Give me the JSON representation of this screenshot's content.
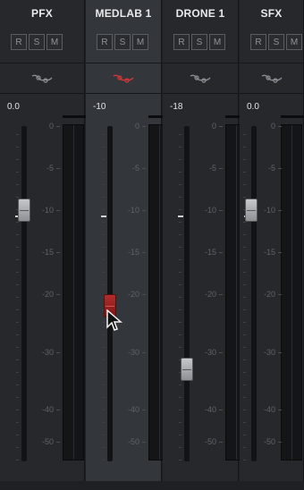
{
  "channels": [
    {
      "name": "PFX",
      "volume": "0.0",
      "selected": false,
      "eq_active": false,
      "fader_db": -10,
      "fader_color": "silver",
      "buttons": {
        "record": "R",
        "solo": "S",
        "mute": "M"
      }
    },
    {
      "name": "MEDLAB 1",
      "volume": "-10",
      "selected": true,
      "eq_active": true,
      "fader_db": -22,
      "fader_color": "red",
      "buttons": {
        "record": "R",
        "solo": "S",
        "mute": "M"
      }
    },
    {
      "name": "DRONE 1",
      "volume": "-18",
      "selected": false,
      "eq_active": false,
      "fader_db": -33,
      "fader_color": "silver",
      "buttons": {
        "record": "R",
        "solo": "S",
        "mute": "M"
      }
    },
    {
      "name": "SFX",
      "volume": "0.0",
      "selected": false,
      "eq_active": false,
      "fader_db": -10,
      "fader_color": "silver",
      "buttons": {
        "record": "R",
        "solo": "S",
        "mute": "M"
      }
    }
  ],
  "scale_labels": [
    "0",
    "-5",
    "-10",
    "-15",
    "-20",
    "-30",
    "-40",
    "-50"
  ],
  "colors": {
    "panel": "#26282c",
    "selected_panel": "#33363b",
    "eq_active": "#d2363a",
    "eq_inactive": "#8a8e94",
    "fader_red": "#a62323"
  },
  "icons": {
    "eq": "eq-curve-icon",
    "cursor": "mouse-pointer-icon"
  }
}
